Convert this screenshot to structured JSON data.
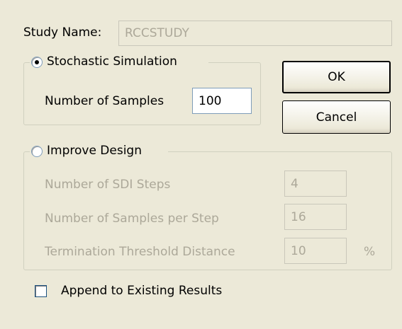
{
  "study_name": {
    "label": "Study Name:",
    "value": "RCCSTUDY"
  },
  "stochastic": {
    "label": "Stochastic Simulation",
    "selected": true,
    "samples_label": "Number of Samples",
    "samples_value": "100"
  },
  "improve": {
    "label": "Improve Design",
    "selected": false,
    "sdi_steps_label": "Number of SDI Steps",
    "sdi_steps_value": "4",
    "samples_per_step_label": "Number of Samples per Step",
    "samples_per_step_value": "16",
    "threshold_label": "Termination Threshold Distance",
    "threshold_value": "10",
    "threshold_unit": "%"
  },
  "buttons": {
    "ok": "OK",
    "cancel": "Cancel"
  },
  "append": {
    "label": "Append to Existing Results",
    "checked": false
  }
}
